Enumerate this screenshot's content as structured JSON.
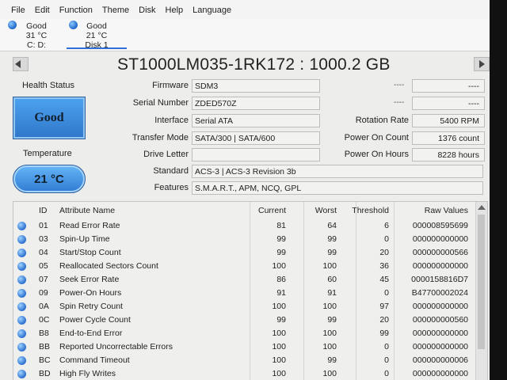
{
  "menu": [
    "File",
    "Edit",
    "Function",
    "Theme",
    "Disk",
    "Help",
    "Language"
  ],
  "disks": [
    {
      "status": "Good",
      "temp": "31 °C",
      "name": "C: D:"
    },
    {
      "status": "Good",
      "temp": "21 °C",
      "name": "Disk 1"
    }
  ],
  "drive": {
    "title": "ST1000LM035-1RK172 : 1000.2 GB",
    "health_label": "Health Status",
    "health": "Good",
    "temp_label": "Temperature",
    "temp": "21 °C",
    "fields": {
      "firmware_label": "Firmware",
      "firmware": "SDM3",
      "serial_label": "Serial Number",
      "serial": "ZDED570Z",
      "interface_label": "Interface",
      "interface": "Serial ATA",
      "transfer_label": "Transfer Mode",
      "transfer": "SATA/300 | SATA/600",
      "letter_label": "Drive Letter",
      "letter": "",
      "standard_label": "Standard",
      "standard": "ACS-3 | ACS-3 Revision 3b",
      "features_label": "Features",
      "features": "S.M.A.R.T., APM, NCQ, GPL"
    },
    "right": {
      "dash": "----",
      "rotation_label": "Rotation Rate",
      "rotation": "5400 RPM",
      "poc_label": "Power On Count",
      "poc": "1376 count",
      "poh_label": "Power On Hours",
      "poh": "8228 hours"
    }
  },
  "table": {
    "headers": {
      "id": "ID",
      "name": "Attribute Name",
      "current": "Current",
      "worst": "Worst",
      "threshold": "Threshold",
      "raw": "Raw Values"
    },
    "rows": [
      {
        "id": "01",
        "name": "Read Error Rate",
        "current": "81",
        "worst": "64",
        "threshold": "6",
        "raw": "000008595699"
      },
      {
        "id": "03",
        "name": "Spin-Up Time",
        "current": "99",
        "worst": "99",
        "threshold": "0",
        "raw": "000000000000"
      },
      {
        "id": "04",
        "name": "Start/Stop Count",
        "current": "99",
        "worst": "99",
        "threshold": "20",
        "raw": "000000000566"
      },
      {
        "id": "05",
        "name": "Reallocated Sectors Count",
        "current": "100",
        "worst": "100",
        "threshold": "36",
        "raw": "000000000000"
      },
      {
        "id": "07",
        "name": "Seek Error Rate",
        "current": "86",
        "worst": "60",
        "threshold": "45",
        "raw": "0000158816D7"
      },
      {
        "id": "09",
        "name": "Power-On Hours",
        "current": "91",
        "worst": "91",
        "threshold": "0",
        "raw": "B47700002024"
      },
      {
        "id": "0A",
        "name": "Spin Retry Count",
        "current": "100",
        "worst": "100",
        "threshold": "97",
        "raw": "000000000000"
      },
      {
        "id": "0C",
        "name": "Power Cycle Count",
        "current": "99",
        "worst": "99",
        "threshold": "20",
        "raw": "000000000560"
      },
      {
        "id": "B8",
        "name": "End-to-End Error",
        "current": "100",
        "worst": "100",
        "threshold": "99",
        "raw": "000000000000"
      },
      {
        "id": "BB",
        "name": "Reported Uncorrectable Errors",
        "current": "100",
        "worst": "100",
        "threshold": "0",
        "raw": "000000000000"
      },
      {
        "id": "BC",
        "name": "Command Timeout",
        "current": "100",
        "worst": "99",
        "threshold": "0",
        "raw": "000000000006"
      },
      {
        "id": "BD",
        "name": "High Fly Writes",
        "current": "100",
        "worst": "100",
        "threshold": "0",
        "raw": "000000000000"
      }
    ]
  },
  "colors": {
    "accent": "#2f76c9",
    "good": "#4da3ef"
  },
  "icons": [
    "disk-status-dot-icon",
    "attribute-status-dot-icon",
    "nav-left-arrow-icon",
    "nav-right-arrow-icon",
    "scroll-up-arrow-icon"
  ]
}
